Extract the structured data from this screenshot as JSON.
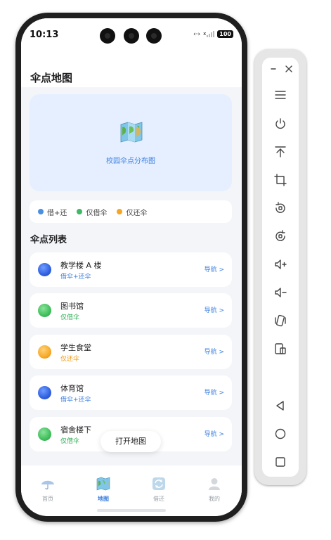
{
  "status_bar": {
    "time": "10:13",
    "signal": "x",
    "battery": "100"
  },
  "header": {
    "title": "伞点地图"
  },
  "map_card": {
    "label": "校园伞点分布图"
  },
  "legend": [
    {
      "label": "借+还",
      "color": "#4a90e2"
    },
    {
      "label": "仅借伞",
      "color": "#3fb868"
    },
    {
      "label": "仅还伞",
      "color": "#f5a623"
    }
  ],
  "list_section": {
    "title": "伞点列表"
  },
  "stations": [
    {
      "name": "教学楼 A 楼",
      "type": "借伞+还伞",
      "type_color": "#3f82e0",
      "ball": "blue",
      "nav": "导航 >"
    },
    {
      "name": "图书馆",
      "type": "仅借伞",
      "type_color": "#2fae57",
      "ball": "green",
      "nav": "导航 >"
    },
    {
      "name": "学生食堂",
      "type": "仅还伞",
      "type_color": "#f39c12",
      "ball": "orange",
      "nav": "导航 >"
    },
    {
      "name": "体育馆",
      "type": "借伞+还伞",
      "type_color": "#3f82e0",
      "ball": "blue",
      "nav": "导航 >"
    },
    {
      "name": "宿舍楼下",
      "type": "仅借伞",
      "type_color": "#2fae57",
      "ball": "green",
      "nav": "导航 >"
    }
  ],
  "open_map_button": {
    "label": "打开地图"
  },
  "tabs": [
    {
      "label": "首页",
      "icon": "umbrella-icon",
      "active": false
    },
    {
      "label": "地图",
      "icon": "map-icon",
      "active": true
    },
    {
      "label": "借还",
      "icon": "refresh-icon",
      "active": false
    },
    {
      "label": "我的",
      "icon": "user-icon",
      "active": false
    }
  ],
  "colors": {
    "accent": "#3f82e0",
    "inactive_tab": "#9aa0a6"
  },
  "emulator_toolbar": {
    "buttons": [
      "minimize-icon",
      "close-icon",
      "menu-icon",
      "power-icon",
      "pin-top-icon",
      "crop-icon",
      "rotate-left-icon",
      "rotate-right-icon",
      "volume-up-icon",
      "volume-down-icon",
      "shake-icon",
      "screenshot-icon",
      "back-icon",
      "home-icon",
      "overview-icon"
    ]
  }
}
